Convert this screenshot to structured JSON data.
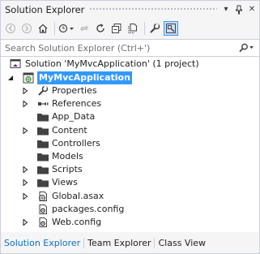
{
  "window": {
    "title": "Solution Explorer",
    "dropdown_glyph": "▾",
    "pin_glyph": "⊥",
    "close_glyph": "✕"
  },
  "search": {
    "placeholder": "Search Solution Explorer (Ctrl+')",
    "value": ""
  },
  "tree": {
    "solution_label": "Solution 'MyMvcApplication' (1 project)",
    "project_label": "MyMvcApplication",
    "items": [
      {
        "label": "Properties",
        "icon": "wrench-icon",
        "expandable": true
      },
      {
        "label": "References",
        "icon": "references-icon",
        "expandable": true
      },
      {
        "label": "App_Data",
        "icon": "folder-icon",
        "expandable": false
      },
      {
        "label": "Content",
        "icon": "folder-icon",
        "expandable": true
      },
      {
        "label": "Controllers",
        "icon": "folder-icon",
        "expandable": false
      },
      {
        "label": "Models",
        "icon": "folder-icon",
        "expandable": false
      },
      {
        "label": "Scripts",
        "icon": "folder-icon",
        "expandable": true
      },
      {
        "label": "Views",
        "icon": "folder-icon",
        "expandable": true
      },
      {
        "label": "Global.asax",
        "icon": "global-asax-icon",
        "expandable": true
      },
      {
        "label": "packages.config",
        "icon": "config-icon",
        "expandable": false
      },
      {
        "label": "Web.config",
        "icon": "config-icon",
        "expandable": true
      }
    ]
  },
  "tabs": [
    {
      "label": "Solution Explorer",
      "active": true
    },
    {
      "label": "Team Explorer",
      "active": false
    },
    {
      "label": "Class View",
      "active": false
    }
  ],
  "colors": {
    "accent": "#3399ff",
    "selection": "#3399ff",
    "active_tab": "#0e70c0",
    "background": "#f5f5f5"
  }
}
